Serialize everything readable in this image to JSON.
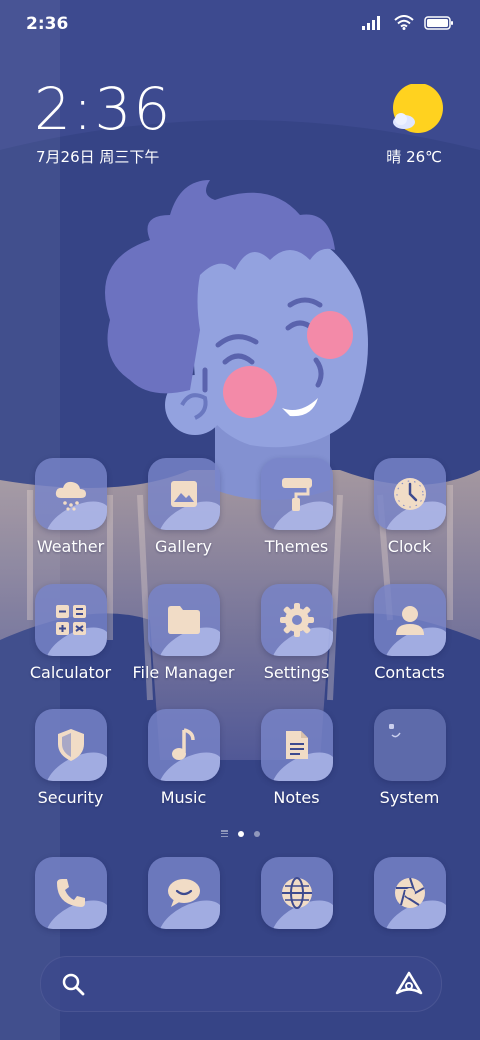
{
  "status_bar": {
    "time": "2:36"
  },
  "clock_widget": {
    "time": "2:36",
    "date": "7月26日 周三下午"
  },
  "weather_widget": {
    "text": "晴 26℃",
    "icon": "sunny-cloud-icon"
  },
  "apps": [
    {
      "label": "Weather",
      "icon": "weather-cloud-icon"
    },
    {
      "label": "Gallery",
      "icon": "gallery-icon"
    },
    {
      "label": "Themes",
      "icon": "paint-roller-icon"
    },
    {
      "label": "Clock",
      "icon": "clock-icon"
    },
    {
      "label": "Calculator",
      "icon": "calculator-icon"
    },
    {
      "label": "File Manager",
      "icon": "folder-icon"
    },
    {
      "label": "Settings",
      "icon": "gear-icon"
    },
    {
      "label": "Contacts",
      "icon": "person-icon"
    },
    {
      "label": "Security",
      "icon": "shield-icon"
    },
    {
      "label": "Music",
      "icon": "music-note-icon"
    },
    {
      "label": "Notes",
      "icon": "note-icon"
    },
    {
      "label": "System",
      "icon": "folder-icon"
    }
  ],
  "dock": [
    {
      "icon": "phone-icon"
    },
    {
      "icon": "message-icon"
    },
    {
      "icon": "browser-globe-icon"
    },
    {
      "icon": "camera-aperture-icon"
    }
  ],
  "pages": {
    "count": 2,
    "current": 1
  },
  "colors": {
    "background": "#3d4a8f",
    "icon_glyph": "#f1dcc6",
    "sun": "#ffd21f"
  }
}
